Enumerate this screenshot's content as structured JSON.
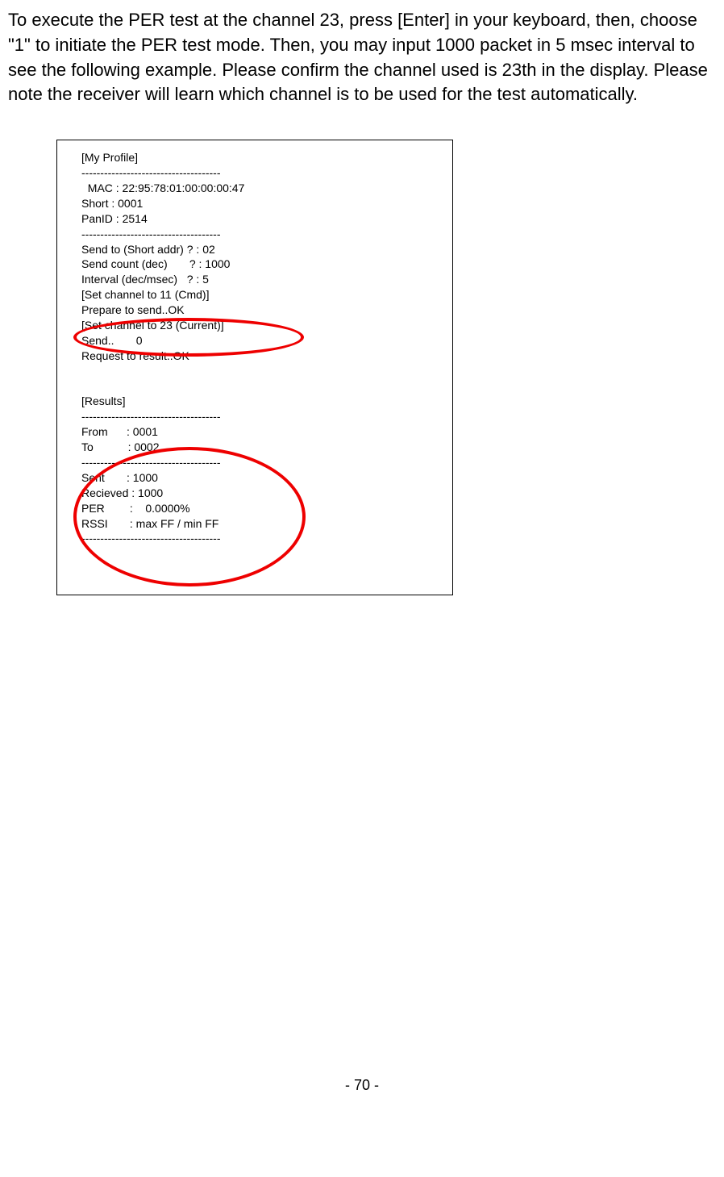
{
  "intro": "To execute the PER test at the channel 23, press [Enter] in your keyboard, then, choose \"1\" to initiate the PER test mode. Then, you may input 1000 packet in 5 msec interval to see the following example. Please confirm the channel used is 23th in the display. Please note the receiver will learn which channel is to be used for the test automatically.",
  "terminal": {
    "profile_header": "[My Profile]",
    "divider": "-------------------------------------",
    "mac": "  MAC : 22:95:78:01:00:00:00:47",
    "short": "Short : 0001",
    "panid": "PanID : 2514",
    "send_to": "Send to (Short addr) ? : 02",
    "send_count": "Send count (dec)       ? : 1000",
    "interval": "Interval (dec/msec)   ? : 5",
    "set_channel_cmd": "[Set channel to 11 (Cmd)]",
    "prepare": "Prepare to send..OK",
    "set_channel_current": "[Set channel to 23 (Current)]",
    "send": "Send..       0",
    "request": "Request to result..OK",
    "results_header": "[Results]",
    "from": "From      : 0001",
    "to": "To           : 0002",
    "sent": "Sent       : 1000",
    "recieved": "Recieved : 1000",
    "per": "PER        :    0.0000%",
    "rssi": "RSSI       : max FF / min FF"
  },
  "page_number": "- 70 -"
}
